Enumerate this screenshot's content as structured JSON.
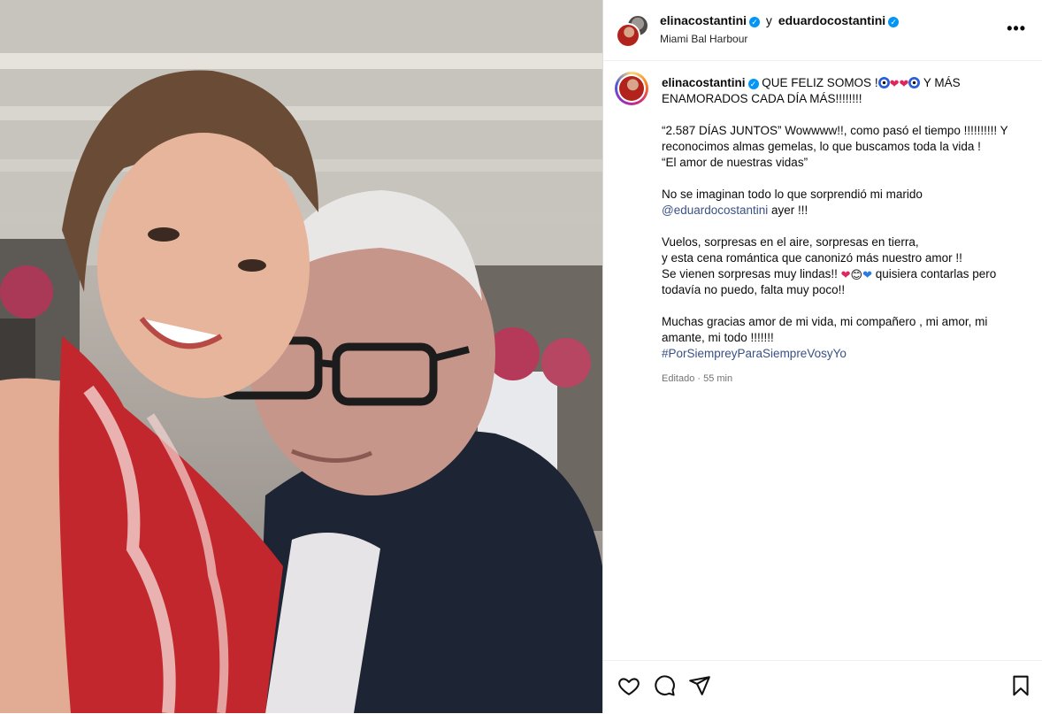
{
  "post": {
    "author1": "elinacostantini",
    "conjunction": "y",
    "author2": "eduardocostantini",
    "location": "Miami Bal Harbour"
  },
  "caption": {
    "username": "elinacostantini",
    "line1_start": "QUE FELIZ SOMOS !",
    "line1_end": " Y MÁS ENAMORADOS CADA DÍA MÁS!!!!!!!!",
    "para2": "“2.587 DÍAS JUNTOS” Wowwww!!, como pasó el tiempo !!!!!!!!!! Y reconocimos almas gemelas, lo que buscamos toda la vida !",
    "para2_quote": "“El amor de nuestras vidas”",
    "para3_start": "No se imaginan todo lo que sorprendió mi marido",
    "mention": "@eduardocostantini",
    "para3_end": " ayer !!!",
    "para4_l1": "Vuelos, sorpresas en el aire, sorpresas en tierra,",
    "para4_l2": "y esta cena romántica que canonizó más nuestro amor !!",
    "para4_l3_start": "Se vienen sorpresas muy lindas!! ",
    "para4_l3_end": " quisiera contarlas pero todavía no puedo, falta muy poco!!",
    "para5": "Muchas gracias amor de mi vida, mi compañero , mi amor, mi amante, mi todo !!!!!!!",
    "hashtag": "#PorSiempreyParaSiempreVosyYo",
    "edited": "Editado",
    "separator": " · ",
    "time": "55 min"
  },
  "icons": {
    "like": "heart-icon",
    "comment": "comment-icon",
    "share": "share-icon",
    "save": "bookmark-icon",
    "more": "more-options-icon",
    "verified": "verified-badge-icon"
  },
  "colors": {
    "verified": "#0095f6",
    "link": "#385185",
    "heart": "#e0245e",
    "dress": "#c1272d"
  }
}
